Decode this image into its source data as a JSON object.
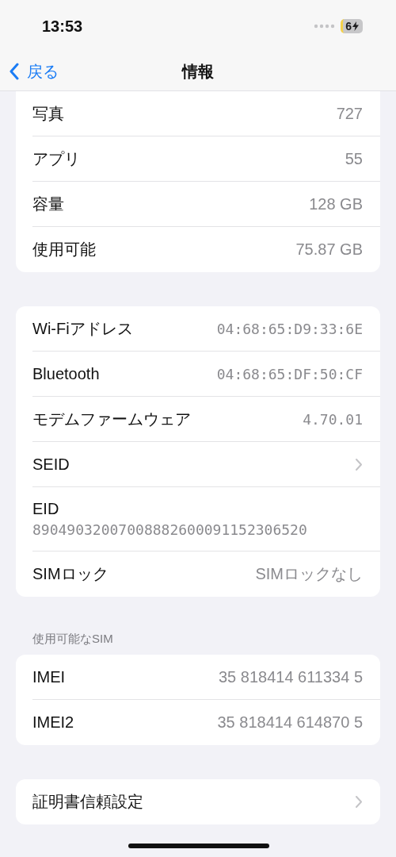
{
  "status_bar": {
    "time": "13:53",
    "battery": "6"
  },
  "nav": {
    "back": "戻る",
    "title": "情報"
  },
  "groups": [
    {
      "rows": [
        {
          "kind": "value",
          "label": "写真",
          "value": "727"
        },
        {
          "kind": "value",
          "label": "アプリ",
          "value": "55"
        },
        {
          "kind": "value",
          "label": "容量",
          "value": "128 GB"
        },
        {
          "kind": "value",
          "label": "使用可能",
          "value": "75.87 GB"
        }
      ]
    },
    {
      "rows": [
        {
          "kind": "mono",
          "label": "Wi-Fiアドレス",
          "value": "04:68:65:D9:33:6E"
        },
        {
          "kind": "mono",
          "label": "Bluetooth",
          "value": "04:68:65:DF:50:CF"
        },
        {
          "kind": "mono",
          "label": "モデムファームウェア",
          "value": "4.70.01"
        },
        {
          "kind": "chevron",
          "label": "SEID"
        },
        {
          "kind": "stacked",
          "label": "EID",
          "value": "89049032007008882600091152306520"
        },
        {
          "kind": "value",
          "label": "SIMロック",
          "value": "SIMロックなし"
        }
      ]
    },
    {
      "header": "使用可能なSIM",
      "rows": [
        {
          "kind": "value",
          "label": "IMEI",
          "value": "35 818414 611334 5"
        },
        {
          "kind": "value",
          "label": "IMEI2",
          "value": "35 818414 614870 5"
        }
      ]
    },
    {
      "rows": [
        {
          "kind": "chevron",
          "label": "証明書信頼設定"
        }
      ]
    }
  ]
}
